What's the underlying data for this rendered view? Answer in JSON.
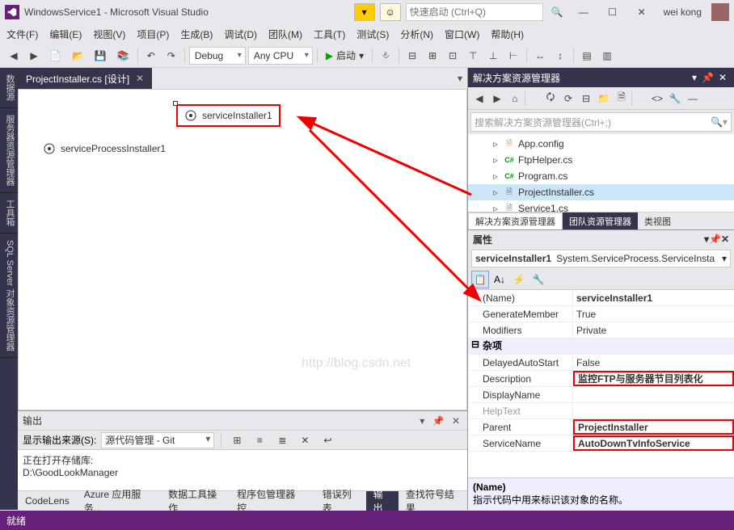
{
  "title": "WindowsService1 - Microsoft Visual Studio",
  "quick_launch_ph": "快速启动 (Ctrl+Q)",
  "user": "wei kong",
  "menu": [
    "文件(F)",
    "编辑(E)",
    "视图(V)",
    "项目(P)",
    "生成(B)",
    "调试(D)",
    "团队(M)",
    "工具(T)",
    "测试(S)",
    "分析(N)",
    "窗口(W)",
    "帮助(H)"
  ],
  "toolbar": {
    "config": "Debug",
    "platform": "Any CPU",
    "start": "启动"
  },
  "doc_tab": "ProjectInstaller.cs [设计]",
  "designer": {
    "comp1": "serviceInstaller1",
    "comp2": "serviceProcessInstaller1"
  },
  "output": {
    "title": "输出",
    "source_lbl": "显示输出来源(S):",
    "source": "源代码管理 - Git",
    "line1": "正在打开存储库:",
    "line2": "D:\\GoodLookManager"
  },
  "bottom_tabs": [
    "CodeLens",
    "Azure 应用服务...",
    "数据工具操作",
    "程序包管理器控...",
    "错误列表",
    "输出",
    "查找符号结果"
  ],
  "se": {
    "title": "解决方案资源管理器",
    "search_ph": "搜索解决方案资源管理器(Ctrl+;)",
    "items": [
      {
        "icon": "cfg",
        "name": "App.config"
      },
      {
        "icon": "cs",
        "name": "FtpHelper.cs"
      },
      {
        "icon": "cs",
        "name": "Program.cs"
      },
      {
        "icon": "cs2",
        "name": "ProjectInstaller.cs",
        "sel": true
      },
      {
        "icon": "cs2",
        "name": "Service1.cs"
      }
    ],
    "tabs": [
      "解决方案资源管理器",
      "团队资源管理器",
      "类视图"
    ]
  },
  "props": {
    "title": "属性",
    "obj_name": "serviceInstaller1",
    "obj_type": "System.ServiceProcess.ServiceInsta",
    "rows": [
      {
        "n": "(Name)",
        "v": "serviceInstaller1",
        "b": 1
      },
      {
        "n": "GenerateMember",
        "v": "True"
      },
      {
        "n": "Modifiers",
        "v": "Private"
      },
      {
        "cat": "杂项"
      },
      {
        "n": "DelayedAutoStart",
        "v": "False"
      },
      {
        "n": "Description",
        "v": "监控FTP与服务器节目列表化",
        "hl": 1,
        "b": 1
      },
      {
        "n": "DisplayName",
        "v": ""
      },
      {
        "n": "HelpText",
        "v": "",
        "dim": 1
      },
      {
        "n": "Parent",
        "v": "ProjectInstaller",
        "hl": 1,
        "b": 1
      },
      {
        "n": "ServiceName",
        "v": "AutoDownTvInfoService",
        "hl": 1,
        "b": 1
      }
    ],
    "desc_name": "(Name)",
    "desc_text": "指示代码中用来标识该对象的名称。"
  },
  "vtabs": [
    "数据源",
    "服务器资源管理器",
    "工具箱",
    "SQL Server 对象资源管理器"
  ],
  "status": "就绪",
  "watermark": "http://blog.csdn.net"
}
